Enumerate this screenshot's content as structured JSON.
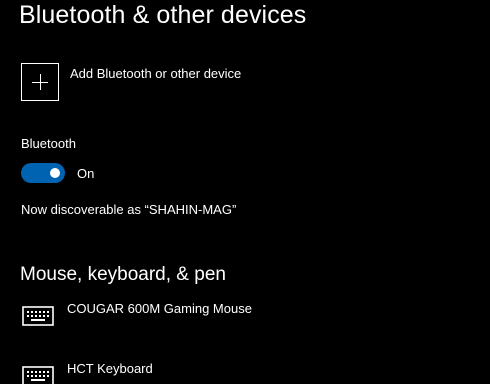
{
  "header": {
    "title": "Bluetooth & other devices"
  },
  "add_device": {
    "label": "Add Bluetooth or other device",
    "icon": "plus-icon"
  },
  "bluetooth": {
    "label": "Bluetooth",
    "state_label": "On",
    "enabled": true,
    "accent_color": "#0063b1",
    "discoverable_text": "Now discoverable as “SHAHIN-MAG”"
  },
  "mouse_keyboard_pen": {
    "heading": "Mouse, keyboard, & pen",
    "devices": [
      {
        "name": "COUGAR 600M Gaming Mouse",
        "icon": "keyboard-icon"
      },
      {
        "name": "HCT Keyboard",
        "icon": "keyboard-icon"
      }
    ]
  }
}
